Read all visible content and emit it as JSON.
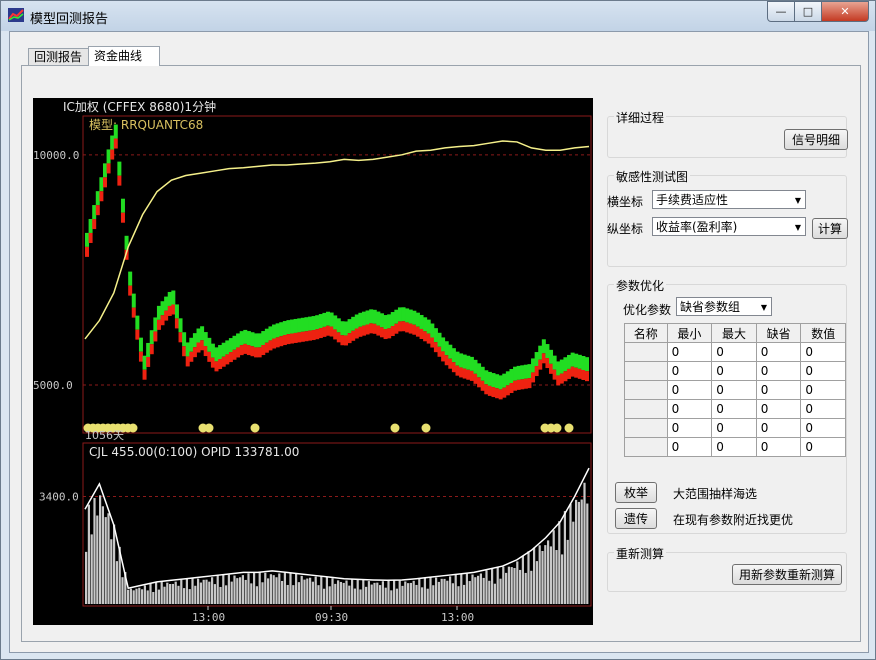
{
  "window": {
    "title": "模型回测报告",
    "buttons": {
      "minimize": "—",
      "maximize": "□",
      "close": "✕"
    }
  },
  "tabs": [
    {
      "label": "回测报告",
      "active": false
    },
    {
      "label": "资金曲线",
      "active": true
    }
  ],
  "chart": {
    "header": "IC加权  (CFFEX 8680)1分钟",
    "model_label": "模型: RRQUANTC68",
    "price_ticks": [
      "10000.0",
      "5000.0"
    ],
    "count_label": "1056天",
    "volume_header": "CJL   455.00(0:100)    OPID 133781.00",
    "volume_ticks": [
      "3400.0"
    ],
    "time_labels": [
      "13:00",
      "09:30",
      "13:00"
    ],
    "colors": {
      "equity": "#f5f08a",
      "price_high": "#22dd22",
      "price_low": "#ee2211",
      "grid": "#8b1a1a",
      "volume": "#c8c8c8",
      "volume_line": "#ffffff"
    }
  },
  "chart_data": {
    "type": "line",
    "title": "",
    "xlabel": "",
    "ylabel": "",
    "x_tick_labels": [
      "13:00",
      "09:30",
      "13:00"
    ],
    "price_panel": {
      "ylim": [
        4000,
        10800
      ],
      "series": [
        {
          "name": "",
          "values": [
            6000,
            6400,
            7000,
            8000,
            8700,
            9200,
            9450,
            9550,
            9600,
            9650,
            9700,
            9720,
            9750,
            9780,
            9780,
            9800,
            9820,
            9850,
            9900,
            9880,
            9900,
            9950,
            10000,
            10080,
            10100,
            10150,
            10180,
            10200,
            10250,
            10300,
            10280,
            10150,
            10100,
            10100,
            10150,
            10180
          ]
        },
        {
          "name": "",
          "values": [
            8000,
            9200,
            10400,
            7200,
            5300,
            6400,
            6800,
            5600,
            6000,
            5500,
            5700,
            5900,
            5800,
            6000,
            6100,
            6150,
            6200,
            6300,
            6050,
            6250,
            6350,
            6200,
            6400,
            6300,
            6100,
            5700,
            5400,
            5300,
            5000,
            4900,
            5100,
            5150,
            5700,
            5200,
            5400,
            5300
          ]
        }
      ]
    },
    "volume_panel": {
      "ylim": [
        0,
        5000
      ],
      "series": [
        {
          "name": "",
          "values": [
            3000,
            3800,
            2500,
            500,
            600,
            700,
            750,
            800,
            850,
            900,
            950,
            1000,
            1000,
            1050,
            1000,
            950,
            900,
            850,
            800,
            780,
            760,
            750,
            760,
            800,
            850,
            900,
            950,
            1000,
            1100,
            1200,
            1400,
            1700,
            2100,
            2600,
            3400,
            4300
          ]
        }
      ]
    }
  },
  "panel": {
    "detail": {
      "title": "详细过程",
      "signal_button": "信号明细"
    },
    "sensitivity": {
      "title": "敏感性测试图",
      "x_label": "横坐标",
      "x_value": "手续费适应性",
      "y_label": "纵坐标",
      "y_value": "收益率(盈利率)",
      "calc_button": "计算"
    },
    "optimize": {
      "title": "参数优化",
      "opt_label": "优化参数",
      "opt_value": "缺省参数组",
      "columns": [
        "名称",
        "最小",
        "最大",
        "缺省",
        "数值"
      ],
      "rows": [
        {
          "name": "",
          "vals": [
            "0",
            "0",
            "0",
            "0"
          ]
        },
        {
          "name": "",
          "vals": [
            "0",
            "0",
            "0",
            "0"
          ]
        },
        {
          "name": "",
          "vals": [
            "0",
            "0",
            "0",
            "0"
          ]
        },
        {
          "name": "",
          "vals": [
            "0",
            "0",
            "0",
            "0"
          ]
        },
        {
          "name": "",
          "vals": [
            "0",
            "0",
            "0",
            "0"
          ]
        },
        {
          "name": "",
          "vals": [
            "0",
            "0",
            "0",
            "0"
          ]
        }
      ],
      "enum_button": "枚举",
      "enum_desc": "大范围抽样海选",
      "genetic_button": "遗传",
      "genetic_desc": "在现有参数附近找更优"
    },
    "recalc": {
      "title": "重新测算",
      "button": "用新参数重新测算"
    }
  }
}
